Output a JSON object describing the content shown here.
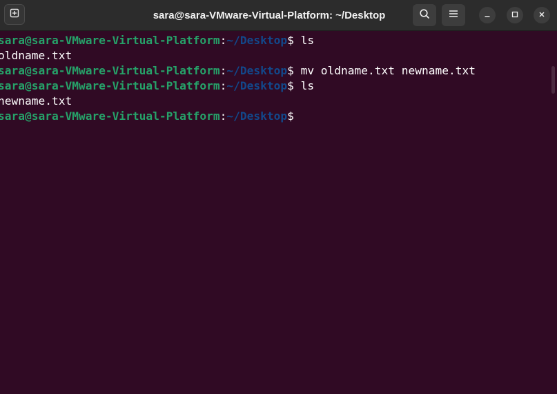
{
  "window": {
    "title": "sara@sara-VMware-Virtual-Platform: ~/Desktop"
  },
  "titlebar": {
    "new_tab_icon": "new-tab-icon",
    "search_icon": "search-icon",
    "menu_icon": "hamburger-menu-icon",
    "minimize_icon": "minimize-icon",
    "maximize_icon": "maximize-icon",
    "close_icon": "close-icon"
  },
  "colors": {
    "background": "#300a24",
    "prompt_user": "#26a269",
    "prompt_path": "#12488b",
    "text": "#ffffff"
  },
  "terminal": {
    "lines": [
      {
        "type": "prompt",
        "user": "sara@sara-VMware-Virtual-Platform",
        "colon": ":",
        "path": "~/Desktop",
        "dollar": "$",
        "command": " ls"
      },
      {
        "type": "output",
        "text": "oldname.txt"
      },
      {
        "type": "prompt",
        "user": "sara@sara-VMware-Virtual-Platform",
        "colon": ":",
        "path": "~/Desktop",
        "dollar": "$",
        "command": " mv oldname.txt newname.txt"
      },
      {
        "type": "prompt",
        "user": "sara@sara-VMware-Virtual-Platform",
        "colon": ":",
        "path": "~/Desktop",
        "dollar": "$",
        "command": " ls"
      },
      {
        "type": "output",
        "text": "newname.txt"
      },
      {
        "type": "prompt",
        "user": "sara@sara-VMware-Virtual-Platform",
        "colon": ":",
        "path": "~/Desktop",
        "dollar": "$",
        "command": ""
      }
    ]
  }
}
